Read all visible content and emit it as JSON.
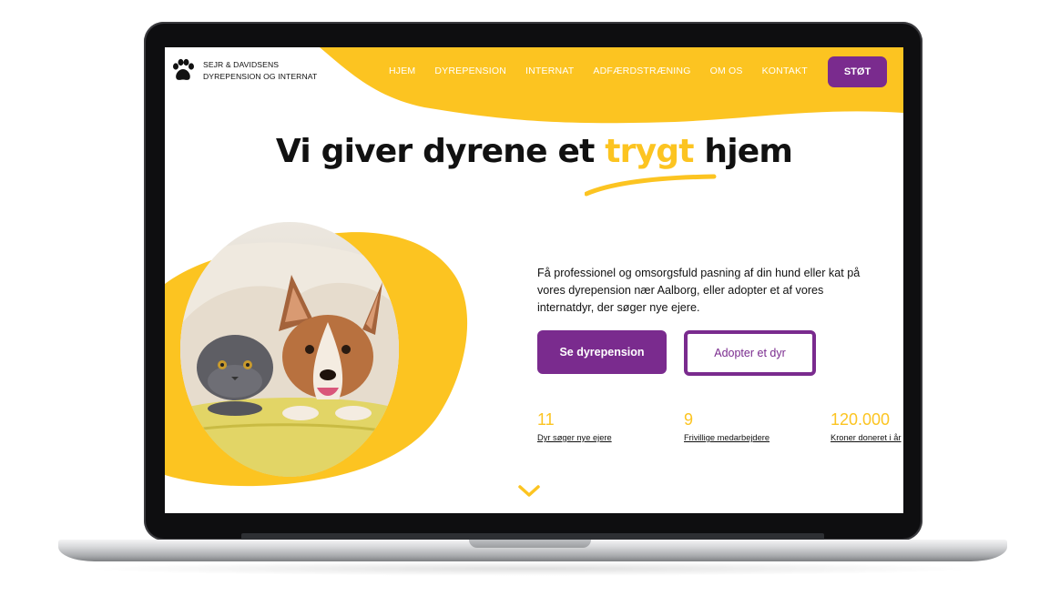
{
  "brand": {
    "line1": "SEJR & DAVIDSENS",
    "line2": "DYREPENSION OG INTERNAT"
  },
  "nav": [
    {
      "label": "HJEM"
    },
    {
      "label": "DYREPENSION"
    },
    {
      "label": "INTERNAT"
    },
    {
      "label": "ADFÆRDSTRÆNING"
    },
    {
      "label": "OM OS"
    },
    {
      "label": "KONTAKT"
    }
  ],
  "cta_top": "STØT",
  "hero": {
    "headline_before": "Vi giver dyrene et ",
    "headline_accent": "trygt",
    "headline_after": " hjem",
    "intro": "Få professionel og omsorgsfuld pasning af din hund eller kat på vores dyrepension nær Aalborg, eller adopter et af vores internatdyr, der søger nye ejere.",
    "primary_button": "Se dyrepension",
    "secondary_button": "Adopter et dyr"
  },
  "stats": [
    {
      "value": "11",
      "label": "Dyr søger nye ejere"
    },
    {
      "value": "9",
      "label": "Frivillige medarbejdere"
    },
    {
      "value": "120.000",
      "label": "Kroner doneret i år"
    }
  ],
  "icons": {
    "logo": "paw-icon",
    "scroll": "chevron-down-icon"
  },
  "colors": {
    "accent_yellow": "#fcc421",
    "brand_purple": "#7a2b8e",
    "text": "#111111"
  }
}
